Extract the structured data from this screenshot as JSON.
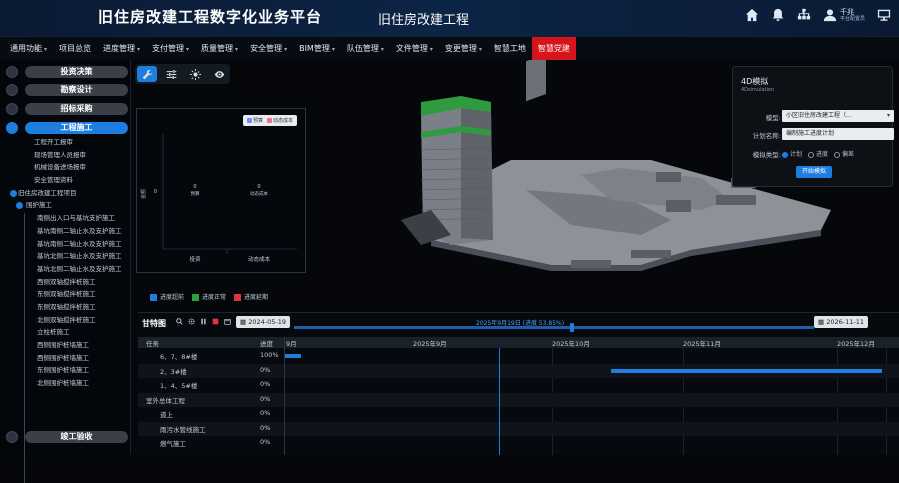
{
  "header": {
    "app_title": "旧住房改建工程数字化业务平台",
    "project_title": "旧住房改建工程",
    "user_name": "千兆",
    "user_role": "平台配置员"
  },
  "nav": [
    {
      "label": "通用功能",
      "caret": true
    },
    {
      "label": "项目总览",
      "caret": false
    },
    {
      "label": "进度管理",
      "caret": true
    },
    {
      "label": "支付管理",
      "caret": true
    },
    {
      "label": "质量管理",
      "caret": true
    },
    {
      "label": "安全管理",
      "caret": true
    },
    {
      "label": "BIM管理",
      "caret": true
    },
    {
      "label": "队伍管理",
      "caret": true
    },
    {
      "label": "文件管理",
      "caret": true
    },
    {
      "label": "变更管理",
      "caret": true
    },
    {
      "label": "智慧工地",
      "caret": false
    },
    {
      "label": "智慧党建",
      "caret": false,
      "active": true
    }
  ],
  "sidebar": {
    "phases": [
      "投资决策",
      "勘察设计",
      "招标采购",
      "工程施工",
      "竣工验收"
    ],
    "active_phase": "工程施工",
    "tree": [
      "工程开工报审",
      "现场管理人员报审",
      "机械设备进场报审",
      "安全管理资料",
      "旧住房改建工程项目",
      "围护施工",
      "南侧出入口与基坑支护施工",
      "基坑南侧二轴止水及支护施工",
      "基坑南侧二轴止水及支护施工",
      "基坑北侧二轴止水及支护施工",
      "基坑北侧二轴止水及支护施工",
      "西侧双轴搅拌桩施工",
      "东侧双轴搅拌桩施工",
      "东侧双轴搅拌桩施工",
      "北侧双轴搅拌桩施工",
      "立柱桩施工",
      "西侧围护桩墙施工",
      "西侧围护桩墙施工",
      "东侧围护桩墙施工",
      "北侧围护桩墙施工"
    ]
  },
  "toolbar": {
    "tools": [
      "wrench-icon",
      "sliders-icon",
      "sun-icon",
      "eye-icon"
    ]
  },
  "chart_data": {
    "type": "bar",
    "categories": [
      "投资",
      "动态成本"
    ],
    "series": [
      {
        "name": "预算",
        "color": "#7b8cf0",
        "values": [
          0,
          0
        ]
      },
      {
        "name": "动态成本",
        "color": "#f36f8a",
        "values": [
          0,
          0
        ]
      }
    ],
    "value_labels": [
      "0\n预算",
      "0\n动态成本"
    ],
    "ylabel": "金额",
    "y_tick": "0"
  },
  "status_legend": [
    {
      "label": "进度超前",
      "color": "#1e7ee0"
    },
    {
      "label": "进度正常",
      "color": "#2ea043"
    },
    {
      "label": "进度延期",
      "color": "#e0343c"
    }
  ],
  "panel_4d": {
    "title": "4D模拟",
    "subtitle": "4Dsimulation",
    "model_label": "模型:",
    "model_value": "小区旧住房改建工程（…",
    "plan_label": "计划名称:",
    "plan_value": "编制施工进度计划",
    "type_label": "模拟类型:",
    "types": [
      "计划",
      "进度",
      "偏差"
    ],
    "selected_type": "计划",
    "start_button": "开始模拟"
  },
  "gantt": {
    "title": "甘特图",
    "start_date": "2024-05-19",
    "end_date": "2026-11-11",
    "current": "2025年9月19日 (进度 53.85%)",
    "col_task": "任务",
    "col_progress": "进度",
    "months": [
      "9月",
      "2025年9月",
      "2025年10月",
      "2025年11月",
      "2025年12月"
    ],
    "rows": [
      {
        "task": "6、7、8#楼",
        "progress": "100%"
      },
      {
        "task": "2、3#楼",
        "progress": "0%"
      },
      {
        "task": "1、4、5#楼",
        "progress": "0%"
      },
      {
        "task": "室外总体工程",
        "progress": "0%"
      },
      {
        "task": "道上",
        "progress": "0%"
      },
      {
        "task": "雨污水管线施工",
        "progress": "0%"
      },
      {
        "task": "燃气施工",
        "progress": "0%"
      }
    ],
    "bars": [
      {
        "start_day": 0,
        "end_day": 3
      },
      {
        "start_day": 60,
        "end_day": 110
      },
      null,
      null,
      null,
      null,
      null
    ]
  }
}
